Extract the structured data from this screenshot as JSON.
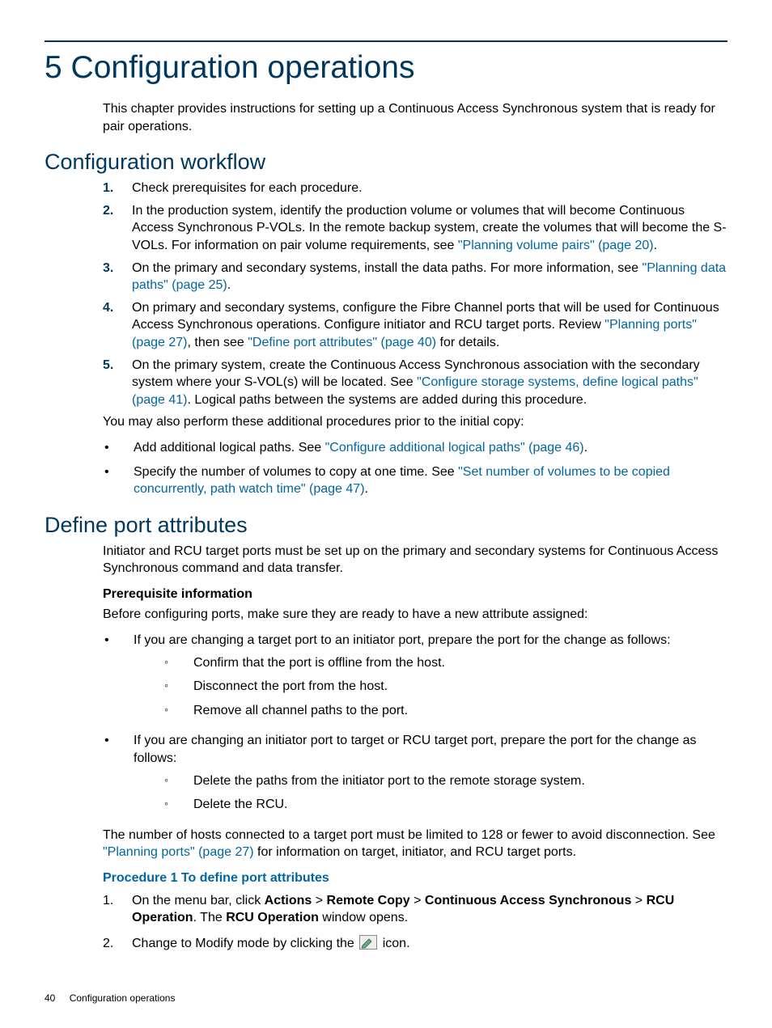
{
  "chapter": {
    "number_title": "5 Configuration operations",
    "intro": "This chapter provides instructions for setting up a Continuous Access Synchronous system that is ready for pair operations."
  },
  "section_workflow": {
    "heading": "Configuration workflow",
    "steps": [
      {
        "n": "1.",
        "text": "Check prerequisites for each procedure."
      },
      {
        "n": "2.",
        "text_a": "In the production system, identify the production volume or volumes that will become Continuous Access Synchronous P-VOLs. In the remote backup system, create the volumes that will become the S-VOLs. For information on pair volume requirements, see ",
        "link1": "\"Planning volume pairs\" (page 20)",
        "text_b": "."
      },
      {
        "n": "3.",
        "text_a": "On the primary and secondary systems, install the data paths. For more information, see ",
        "link1": "\"Planning data paths\" (page 25)",
        "text_b": "."
      },
      {
        "n": "4.",
        "text_a": "On primary and secondary systems, configure the Fibre Channel ports that will be used for Continuous Access Synchronous operations. Configure initiator and RCU target ports. Review ",
        "link1": "\"Planning ports\" (page 27)",
        "text_mid": ", then see ",
        "link2": "\"Define port attributes\" (page 40)",
        "text_b": " for details."
      },
      {
        "n": "5.",
        "text_a": "On the primary system, create the Continuous Access Synchronous association with the secondary system where your S-VOL(s) will be located. See ",
        "link1": "\"Configure storage systems, define logical paths\" (page 41)",
        "text_b": ". Logical paths between the systems are added during this procedure."
      }
    ],
    "additional_intro": "You may also perform these additional procedures prior to the initial copy:",
    "additional": [
      {
        "text_a": "Add additional logical paths. See ",
        "link1": "\"Configure additional logical paths\" (page 46)",
        "text_b": "."
      },
      {
        "text_a": "Specify the number of volumes to copy at one time. See ",
        "link1": "\"Set number of volumes to be copied concurrently, path watch time\" (page 47)",
        "text_b": "."
      }
    ]
  },
  "section_define": {
    "heading": "Define port attributes",
    "intro": "Initiator and RCU target ports must be set up on the primary and secondary systems for Continuous Access Synchronous command and data transfer.",
    "prereq_label": "Prerequisite information",
    "prereq_intro": "Before configuring ports, make sure they are ready to have a new attribute assigned:",
    "prereq_bullets": [
      {
        "text": "If you are changing a target port to an initiator port, prepare the port for the change as follows:",
        "subs": [
          "Confirm that the port is offline from the host.",
          "Disconnect the port from the host.",
          "Remove all channel paths to the port."
        ]
      },
      {
        "text": "If you are changing an initiator port to target or RCU target port, prepare the port for the change as follows:",
        "subs": [
          "Delete the paths from the initiator port to the remote storage system.",
          "Delete the RCU."
        ]
      }
    ],
    "host_limit_a": "The number of hosts connected to a target port must be limited to 128 or fewer to avoid disconnection. See ",
    "host_limit_link": "\"Planning ports\" (page 27)",
    "host_limit_b": " for information on target, initiator, and RCU target ports.",
    "proc_heading": "Procedure 1 To define port attributes",
    "proc_steps": {
      "s1": {
        "n": "1.",
        "pre": "On the menu bar, click ",
        "b1": "Actions",
        "gt1": " > ",
        "b2": "Remote Copy",
        "gt2": " > ",
        "b3": "Continuous Access Synchronous",
        "gt3": " > ",
        "b4": "RCU Operation",
        "mid": ". The ",
        "b5": "RCU Operation",
        "post": " window opens."
      },
      "s2": {
        "n": "2.",
        "pre": "Change to Modify mode by clicking the ",
        "post": " icon."
      }
    }
  },
  "footer": {
    "page_number": "40",
    "running": "Configuration operations"
  }
}
